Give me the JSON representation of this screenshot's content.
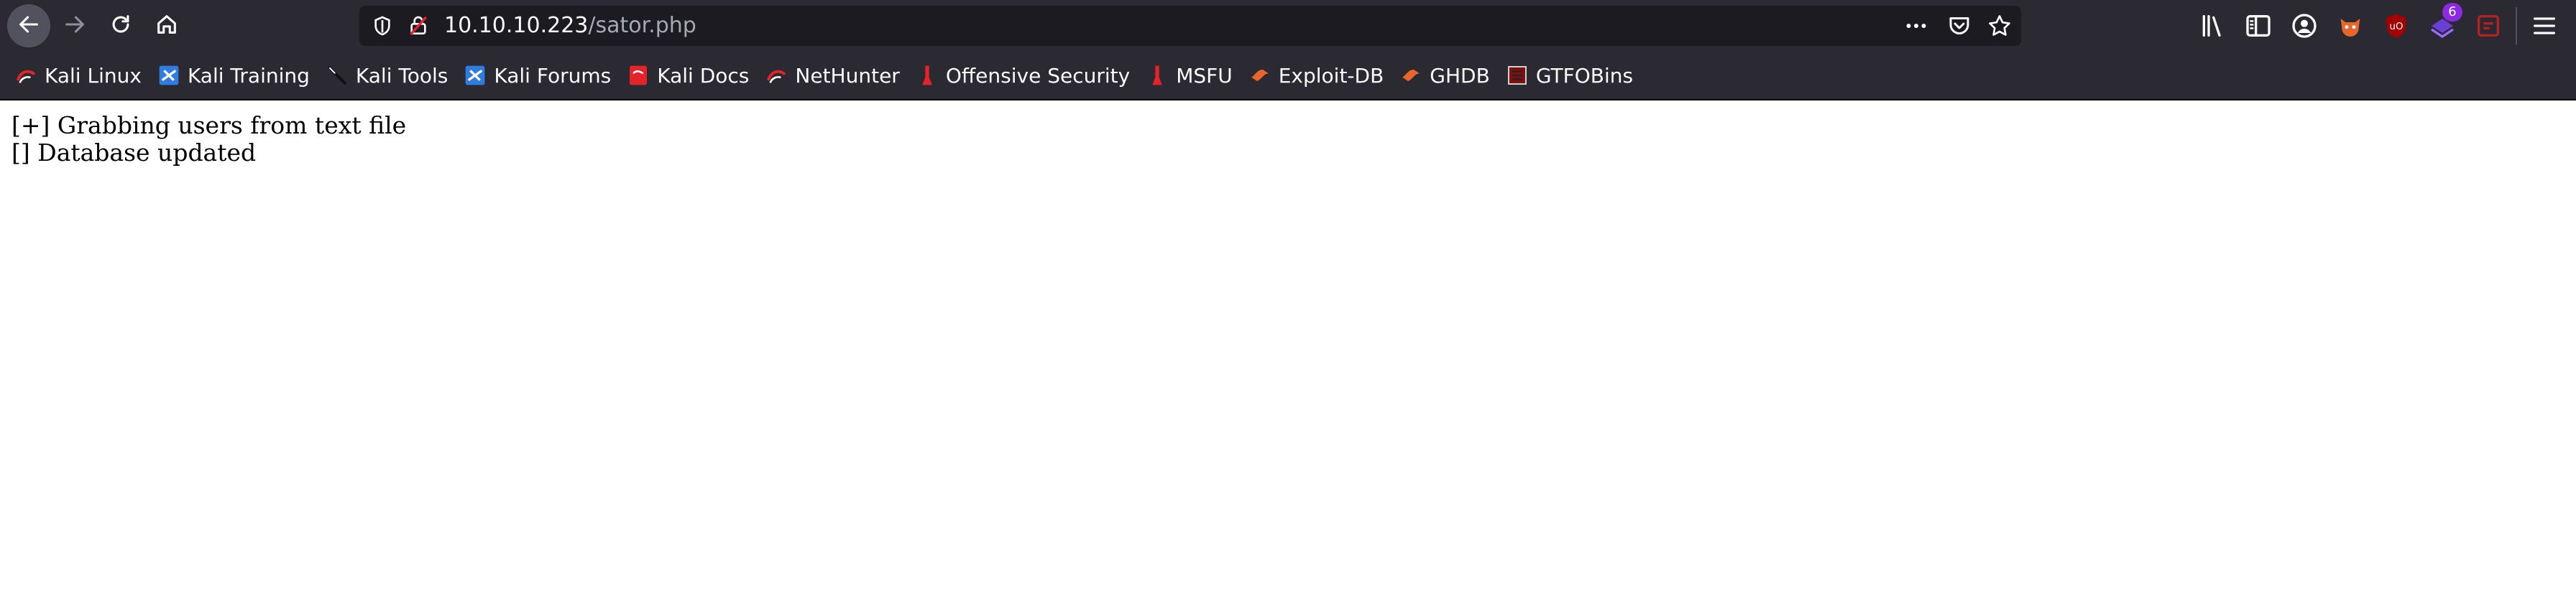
{
  "browser": {
    "url_host": "10.10.10.223",
    "url_path": "/sator.php",
    "extension_badge": "6"
  },
  "bookmarks": [
    {
      "label": "Kali Linux",
      "icon": "kali-dragon-icon"
    },
    {
      "label": "Kali Training",
      "icon": "kali-training-icon"
    },
    {
      "label": "Kali Tools",
      "icon": "kali-tools-icon"
    },
    {
      "label": "Kali Forums",
      "icon": "kali-forums-icon"
    },
    {
      "label": "Kali Docs",
      "icon": "kali-docs-icon"
    },
    {
      "label": "NetHunter",
      "icon": "nethunter-icon"
    },
    {
      "label": "Offensive Security",
      "icon": "offsec-icon"
    },
    {
      "label": "MSFU",
      "icon": "msfu-icon"
    },
    {
      "label": "Exploit-DB",
      "icon": "exploit-db-icon"
    },
    {
      "label": "GHDB",
      "icon": "ghdb-icon"
    },
    {
      "label": "GTFOBins",
      "icon": "gtfobins-icon"
    }
  ],
  "page": {
    "lines": [
      "[+] Grabbing users from text file",
      "[] Database updated"
    ]
  },
  "colors": {
    "toolbar": "#2b2a33",
    "urlbar": "#1c1b22",
    "kali_red": "#e3242b",
    "kali_blue": "#2f7ce0",
    "exploit_orange": "#e8662b"
  }
}
